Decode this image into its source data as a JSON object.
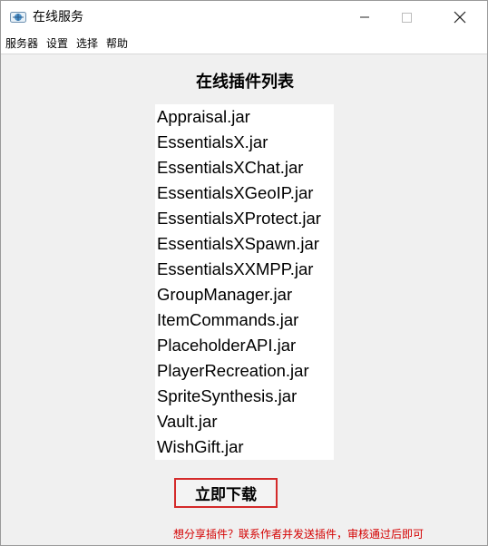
{
  "window": {
    "title": "在线服务",
    "icons": {
      "app": "app-icon",
      "minimize": "minimize-icon",
      "maximize": "maximize-icon",
      "close": "close-icon"
    }
  },
  "menu": {
    "items": [
      "服务器",
      "设置",
      "选择",
      "帮助"
    ]
  },
  "plugin_list": {
    "heading": "在线插件列表",
    "items": [
      "Appraisal.jar",
      "EssentialsX.jar",
      "EssentialsXChat.jar",
      "EssentialsXGeoIP.jar",
      "EssentialsXProtect.jar",
      "EssentialsXSpawn.jar",
      "EssentialsXXMPP.jar",
      "GroupManager.jar",
      "ItemCommands.jar",
      "PlaceholderAPI.jar",
      "PlayerRecreation.jar",
      "SpriteSynthesis.jar",
      "Vault.jar",
      "WishGift.jar"
    ]
  },
  "actions": {
    "download_label": "立即下载"
  },
  "footer": {
    "share_hint": "想分享插件？联系作者并发送插件，审核通过后即可"
  },
  "colors": {
    "window_bg": "#f0f0f0",
    "accent_red": "#d42a2a",
    "hint_red": "#d40000"
  }
}
